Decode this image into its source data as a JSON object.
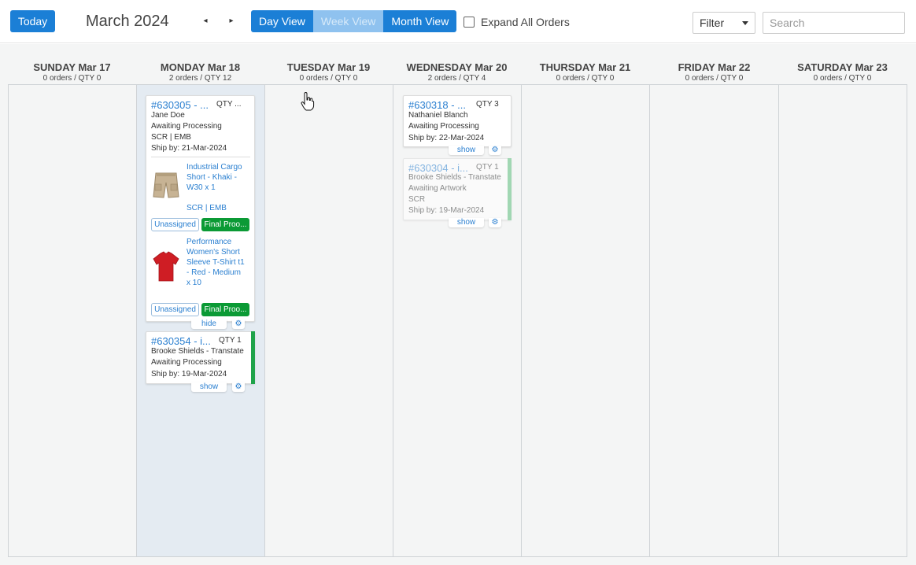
{
  "toolbar": {
    "today_label": "Today",
    "month_title": "March 2024",
    "prev_glyph": "◂",
    "next_glyph": "▸",
    "views": [
      "Day View",
      "Week View",
      "Month View"
    ],
    "expand_label": "Expand All Orders",
    "filter_label": "Filter",
    "search_placeholder": "Search"
  },
  "days": [
    {
      "name": "SUNDAY Mar 17",
      "summary": "0 orders / QTY 0"
    },
    {
      "name": "MONDAY Mar 18",
      "summary": "2 orders / QTY 12"
    },
    {
      "name": "TUESDAY Mar 19",
      "summary": "0 orders / QTY 0"
    },
    {
      "name": "WEDNESDAY Mar 20",
      "summary": "2 orders / QTY 4"
    },
    {
      "name": "THURSDAY Mar 21",
      "summary": "0 orders / QTY 0"
    },
    {
      "name": "FRIDAY Mar 22",
      "summary": "0 orders / QTY 0"
    },
    {
      "name": "SATURDAY Mar 23",
      "summary": "0 orders / QTY 0"
    }
  ],
  "orders": {
    "o630305": {
      "id": "#630305 - ...",
      "qty": "QTY ...",
      "customer": "Jane Doe",
      "status": "Awaiting Processing",
      "decoration": "SCR | EMB",
      "ship_by": "Ship by: 21-Mar-2024",
      "items": [
        {
          "name": "Industrial Cargo Short - Khaki - W30 x 1",
          "decoration": "SCR | EMB",
          "assignee": "Unassigned",
          "stage": "Final Proo...",
          "icon": "cargo-shorts-thumbnail"
        },
        {
          "name": "Performance Women's Short Sleeve T-Shirt t1 - Red - Medium x 10",
          "assignee": "Unassigned",
          "stage": "Final Proo...",
          "icon": "red-tshirt-thumbnail"
        }
      ],
      "toggle_label": "hide"
    },
    "o630354": {
      "id": "#630354 - i...",
      "qty": "QTY 1",
      "customer": "Brooke Shields - Transtate",
      "status": "Awaiting Processing",
      "ship_by": "Ship by: 19-Mar-2024",
      "toggle_label": "show"
    },
    "o630318": {
      "id": "#630318 - ...",
      "qty": "QTY 3",
      "customer": "Nathaniel Blanch",
      "status": "Awaiting Processing",
      "ship_by": "Ship by: 22-Mar-2024",
      "toggle_label": "show"
    },
    "o630304": {
      "id": "#630304 - i...",
      "qty": "QTY 1",
      "customer": "Brooke Shields - Transtate",
      "status": "Awaiting Artwork",
      "decoration": "SCR",
      "ship_by": "Ship by: 19-Mar-2024",
      "toggle_label": "show"
    }
  },
  "icons": {
    "gear": "gear-icon",
    "cursor": "hand-pointer-cursor"
  },
  "colors": {
    "accent": "#1b7fd6",
    "link": "#2a7fd0",
    "success": "#0b9a35",
    "highlight_column": "#e4ebf2"
  }
}
